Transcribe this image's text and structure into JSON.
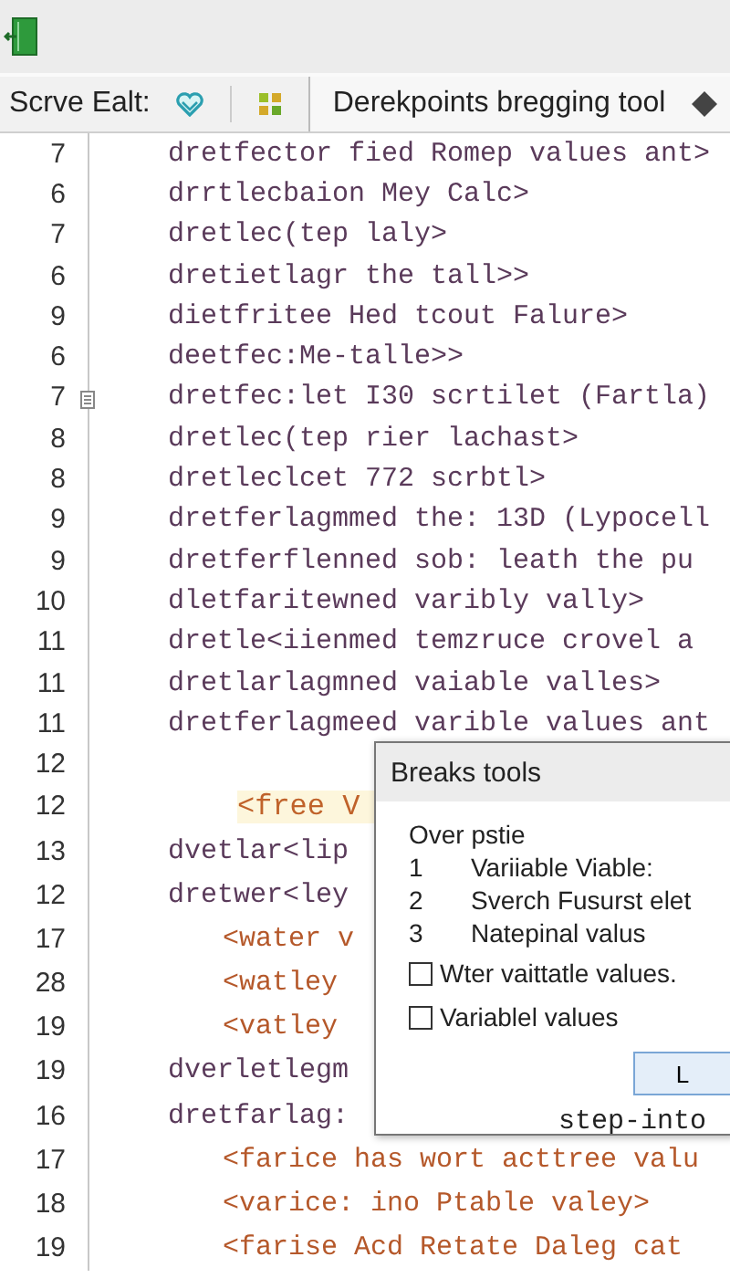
{
  "toolbar": {
    "label": "Scrve Ealt:"
  },
  "tab": {
    "label": "Derekpoints bregging tool",
    "selected": true
  },
  "lines": [
    {
      "number": "7",
      "kind": "code",
      "text": "dretfector fied Romep values ant>",
      "fold": false
    },
    {
      "number": "6",
      "kind": "code",
      "text": "drrtlecbaion Mey Calc>",
      "fold": false
    },
    {
      "number": "7",
      "kind": "code",
      "text": "dretlec(tep laly>",
      "fold": false
    },
    {
      "number": "6",
      "kind": "code",
      "text": "dretietlagr the tall>>",
      "fold": false
    },
    {
      "number": "9",
      "kind": "code",
      "text": "dietfritee Hed tcout Falure>",
      "fold": false
    },
    {
      "number": "6",
      "kind": "code",
      "text": "deetfec:Me-talle>>",
      "fold": false
    },
    {
      "number": "7",
      "kind": "code",
      "text": "dretfec:let I30 scrtilet (Fartla)",
      "fold": true
    },
    {
      "number": "8",
      "kind": "code",
      "text": "dretlec(tep rier lachast>",
      "fold": false
    },
    {
      "number": "8",
      "kind": "code",
      "text": "dretleclcet 772 scrbtl>",
      "fold": false
    },
    {
      "number": "9",
      "kind": "code",
      "text": "dretferlagmmed the: 13D (Lypocell",
      "fold": false
    },
    {
      "number": "9",
      "kind": "code",
      "text": "dretferflenned sob: leath the pu",
      "fold": false
    },
    {
      "number": "10",
      "kind": "code",
      "text": "dletfaritewned varibly vally>",
      "fold": false
    },
    {
      "number": "11",
      "kind": "code",
      "text": "dretle<iienmed temzruce crovel a",
      "fold": false
    },
    {
      "number": "11",
      "kind": "code",
      "text": "dretlarlagmned vaiable valles>",
      "fold": false
    },
    {
      "number": "11",
      "kind": "code",
      "text": "dretferlagmeed varible values ant",
      "fold": false
    },
    {
      "number": "12",
      "kind": "blank",
      "fold": false
    },
    {
      "number": "12",
      "kind": "highlight",
      "text": "<free V",
      "fold": false
    },
    {
      "number": "13",
      "kind": "code",
      "text": "dvetlar<lip",
      "fold": false
    },
    {
      "number": "12",
      "kind": "code",
      "text": "dretwer<ley",
      "fold": false
    },
    {
      "number": "17",
      "kind": "tag",
      "text": "<water v",
      "fold": false
    },
    {
      "number": "28",
      "kind": "tag",
      "text": "<watley",
      "fold": false
    },
    {
      "number": "19",
      "kind": "tag",
      "text": "<vatley",
      "fold": false
    },
    {
      "number": "19",
      "kind": "code",
      "text": "dverletlegm",
      "fold": false
    },
    {
      "number": "16",
      "kind": "code",
      "text": "dretfarlag:",
      "fold": false
    },
    {
      "number": "17",
      "kind": "tag",
      "text": "<farice has wort acttree valu",
      "fold": false
    },
    {
      "number": "18",
      "kind": "tag",
      "text": "<varice: ino Ptable valey>",
      "fold": false
    },
    {
      "number": "19",
      "kind": "tag",
      "text": "<farise Acd Retate Daleg cat",
      "fold": false
    }
  ],
  "dialog": {
    "title": "Breaks tools",
    "heading": "Over pstie",
    "items": [
      {
        "number": "1",
        "text": "Variiable Viable:"
      },
      {
        "number": "2",
        "text": "Sverch Fusurst elet"
      },
      {
        "number": "3",
        "text": "Natepinal valus"
      }
    ],
    "options": [
      {
        "label": "Wter vaittatle values.",
        "checked": false
      },
      {
        "label": "Variablel values",
        "checked": false
      }
    ],
    "button": "L",
    "footer": "step-into"
  }
}
